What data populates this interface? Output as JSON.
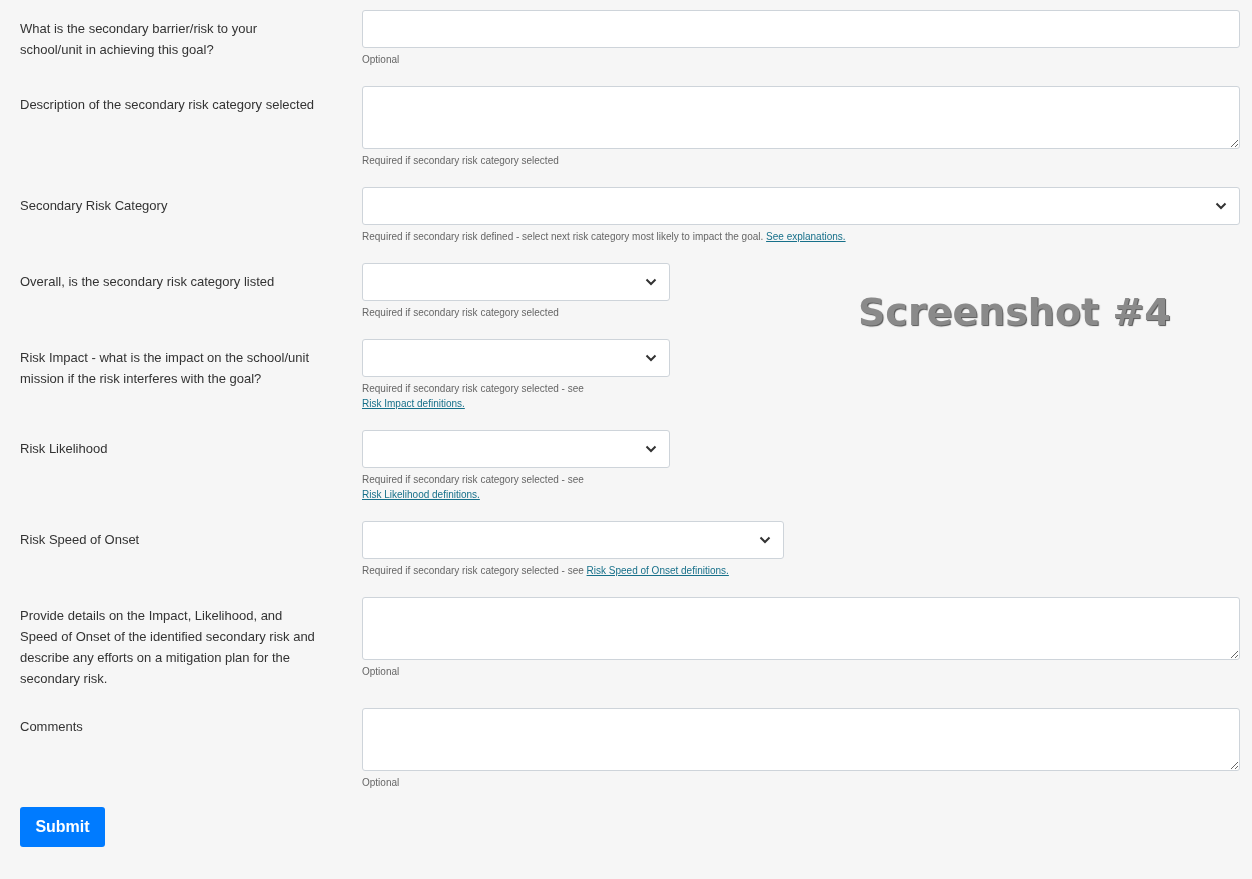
{
  "fields": [
    {
      "label": "What is the secondary barrier/risk to your school/unit in achieving this goal?",
      "kind": "text",
      "help": {
        "text": "Optional"
      }
    },
    {
      "label": "Description of the secondary risk category selected",
      "kind": "textarea",
      "help": {
        "text": "Required if secondary risk category selected"
      }
    },
    {
      "label": "Secondary Risk Category",
      "kind": "select",
      "help": {
        "text": "Required if secondary risk defined - select next risk category most likely to impact the goal.",
        "link": "See explanations."
      }
    },
    {
      "label": "Overall, is the secondary risk category listed",
      "kind": "shortselect",
      "help": {
        "text": "Required if secondary risk category selected"
      }
    },
    {
      "label": "Risk Impact - what is the impact on the school/unit mission if the risk interferes with the goal?",
      "kind": "shortselect",
      "help": {
        "text": "Required if secondary risk category selected - see",
        "link": "Risk Impact definitions."
      }
    },
    {
      "label": "Risk Likelihood",
      "kind": "shortselect",
      "help": {
        "text": "Required if secondary risk category selected - see",
        "link": "Risk Likelihood definitions."
      }
    },
    {
      "label": "Risk Speed of Onset",
      "kind": "midselect",
      "help": {
        "text": "Required if secondary risk category selected - see",
        "link": "Risk Speed of Onset definitions."
      }
    },
    {
      "label": "Provide details on the Impact, Likelihood, and Speed of Onset of the identified secondary risk and describe any efforts on a mitigation plan for the secondary risk.",
      "kind": "textarea",
      "help": {
        "text": "Optional"
      }
    },
    {
      "label": "Comments",
      "kind": "textarea",
      "help": {
        "text": "Optional"
      }
    }
  ],
  "submit": "Submit",
  "annotation": "Screenshot #4"
}
